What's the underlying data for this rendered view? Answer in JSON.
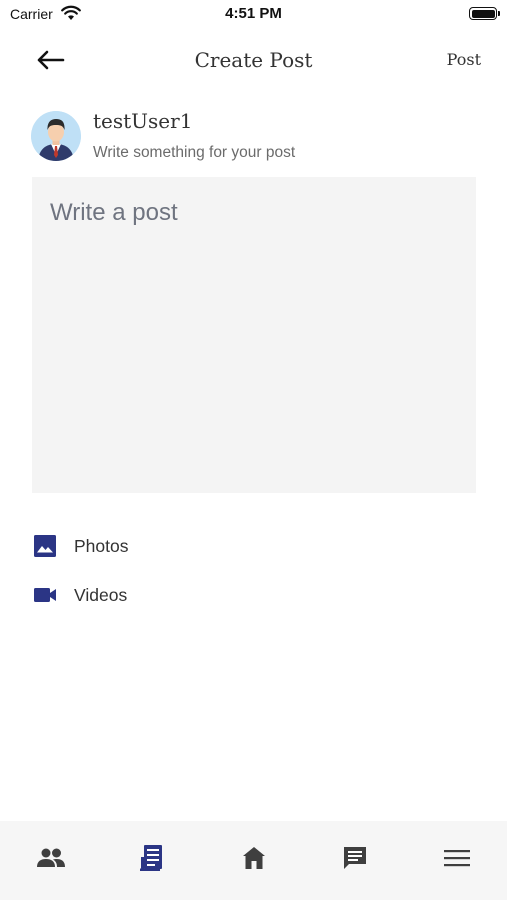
{
  "status_bar": {
    "carrier": "Carrier",
    "time": "4:51 PM"
  },
  "header": {
    "title": "Create Post",
    "post_label": "Post"
  },
  "user": {
    "name": "testUser1",
    "subtitle": "Write something for your post"
  },
  "post": {
    "placeholder": "Write a post",
    "value": ""
  },
  "media_options": [
    {
      "label": "Photos",
      "icon": "image-icon"
    },
    {
      "label": "Videos",
      "icon": "videocam-icon"
    }
  ],
  "bottom_nav": [
    {
      "icon": "people-icon",
      "active": false
    },
    {
      "icon": "newspaper-icon",
      "active": true
    },
    {
      "icon": "home-icon",
      "active": false
    },
    {
      "icon": "chat-icon",
      "active": false
    },
    {
      "icon": "menu-icon",
      "active": false
    }
  ],
  "colors": {
    "accent": "#2b3585",
    "icon_gray": "#3f3f3f",
    "nav_bg": "#f6f6f6",
    "input_bg": "#f4f4f4"
  }
}
